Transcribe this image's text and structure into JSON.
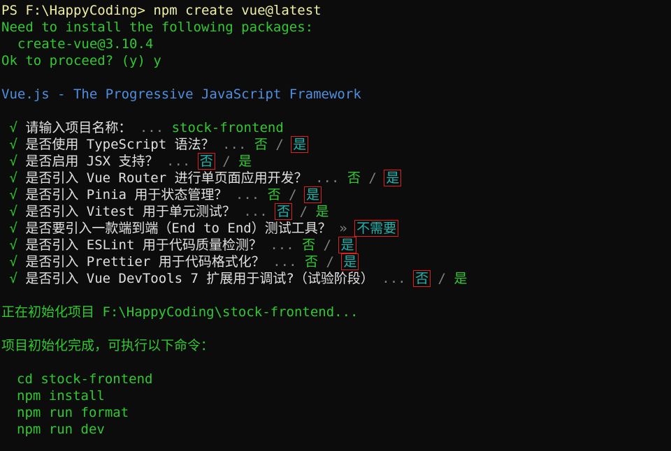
{
  "prompt": {
    "ps": "PS F:\\HappyCoding>",
    "cmd": "npm create vue@latest"
  },
  "install": {
    "need": "Need to install the following packages:",
    "pkg": "create-vue@3.10.4",
    "proceed": "Ok to proceed? (y) y"
  },
  "banner": "Vue.js - The Progressive JavaScript Framework",
  "check": "√",
  "dots": "...",
  "sep": "/",
  "arrow": "»",
  "questions": [
    {
      "q": "请输入项目名称：",
      "answer": "stock-frontend"
    },
    {
      "q": "是否使用 TypeScript 语法？",
      "no": "否",
      "yes": "是",
      "selected": "yes"
    },
    {
      "q": "是否启用 JSX 支持？",
      "no": "否",
      "yes": "是",
      "selected": "no"
    },
    {
      "q": "是否引入 Vue Router 进行单页面应用开发？",
      "no": "否",
      "yes": "是",
      "selected": "yes"
    },
    {
      "q": "是否引入 Pinia 用于状态管理？",
      "no": "否",
      "yes": "是",
      "selected": "yes"
    },
    {
      "q": "是否引入 Vitest 用于单元测试？",
      "no": "否",
      "yes": "是",
      "selected": "no"
    },
    {
      "q": "是否要引入一款端到端（End to End）测试工具？",
      "answer": "不需要"
    },
    {
      "q": "是否引入 ESLint 用于代码质量检测？",
      "no": "否",
      "yes": "是",
      "selected": "yes"
    },
    {
      "q": "是否引入 Prettier 用于代码格式化？",
      "no": "否",
      "yes": "是",
      "selected": "yes"
    },
    {
      "q": "是否引入 Vue DevTools 7 扩展用于调试?（试验阶段）",
      "no": "否",
      "yes": "是",
      "selected": "no"
    }
  ],
  "init": "正在初始化项目 F:\\HappyCoding\\stock-frontend...",
  "done": "项目初始化完成，可执行以下命令：",
  "commands": [
    "cd stock-frontend",
    "npm install",
    "npm run format",
    "npm run dev"
  ],
  "colors": {
    "background": "#0c0c0c",
    "prompt": "#f0f0a0",
    "text": "#32c832",
    "banner": "#4f8fe0",
    "selected": "#20b2aa",
    "highlight_box": "#e02020"
  }
}
